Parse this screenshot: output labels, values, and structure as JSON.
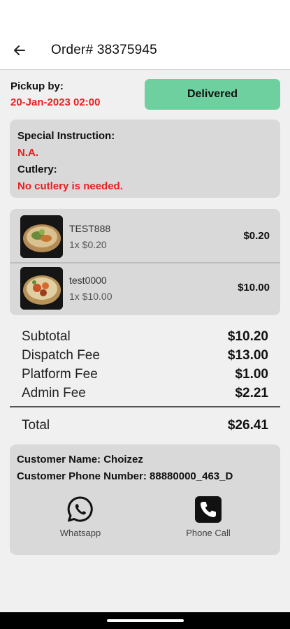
{
  "header": {
    "title": "Order# 38375945",
    "back_icon": "arrow-left-icon"
  },
  "pickup": {
    "label": "Pickup by:",
    "date": "20-Jan-2023 02:00",
    "status": "Delivered",
    "status_color": "#6ecf9f"
  },
  "instructions": {
    "special_label": "Special Instruction:",
    "special_value": "N.A.",
    "cutlery_label": "Cutlery:",
    "cutlery_value": "No cutlery is needed."
  },
  "items": [
    {
      "name": "TEST888",
      "qty": "1x $0.20",
      "price": "$0.20",
      "image": "food-bowl-image"
    },
    {
      "name": "test0000",
      "qty": "1x $10.00",
      "price": "$10.00",
      "image": "food-bowl-image"
    }
  ],
  "summary": [
    {
      "label": "Subtotal",
      "value": "$10.20"
    },
    {
      "label": "Dispatch Fee",
      "value": "$13.00"
    },
    {
      "label": "Platform Fee",
      "value": "$1.00"
    },
    {
      "label": "Admin Fee",
      "value": "$2.21"
    }
  ],
  "total": {
    "label": "Total",
    "value": "$26.41"
  },
  "customer": {
    "name_line": "Customer Name: Choizez",
    "phone_line": "Customer Phone Number: 88880000_463_D",
    "whatsapp_label": "Whatsapp",
    "whatsapp_icon": "whatsapp-icon",
    "phone_label": "Phone Call",
    "phone_icon": "phone-icon"
  },
  "colors": {
    "accent_red": "#e52121",
    "card_bg": "#d9d9d9",
    "page_bg": "#f0f0f0"
  }
}
